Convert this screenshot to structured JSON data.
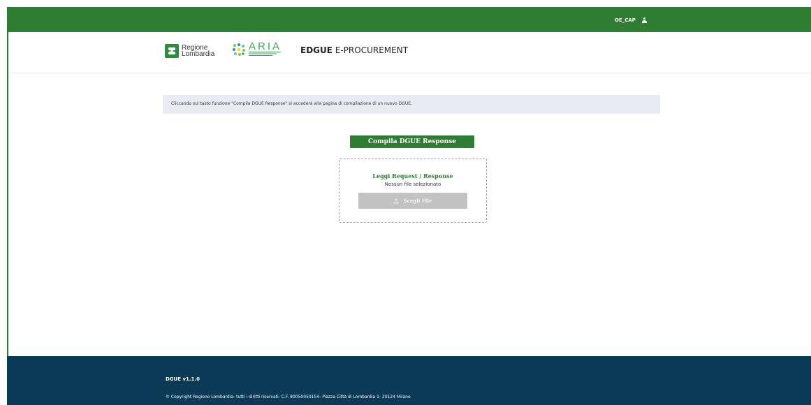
{
  "topbar": {
    "username": "OE_CAP",
    "user_icon": "user-icon",
    "color": "#2e7d32"
  },
  "header": {
    "regione_logo": {
      "line1": "Regione",
      "line2": "Lombardia"
    },
    "aria_logo": {
      "word": "ARIA"
    },
    "title_bold": "EDGUE",
    "title_rest": " E-PROCUREMENT"
  },
  "main": {
    "info_text": "Cliccando sul tasto funzione \"Compila DGUE Response\" si accederà alla pagina di compilazione di un nuovo DGUE.",
    "compila_label": "Compila DGUE Response",
    "upload": {
      "title": "Leggi Request / Response",
      "status": "Nessun file selezionato",
      "choose_label": "Scegli File",
      "choose_icon": "upload-icon"
    }
  },
  "footer": {
    "version": "DGUE v1.1.0",
    "copyright": "© Copyright Regione Lombardia- tutti i diritti riservati- C.F. 80050050154- Piazza Città di Lombardia 1- 20124 Milano",
    "color": "#0b3a57"
  }
}
